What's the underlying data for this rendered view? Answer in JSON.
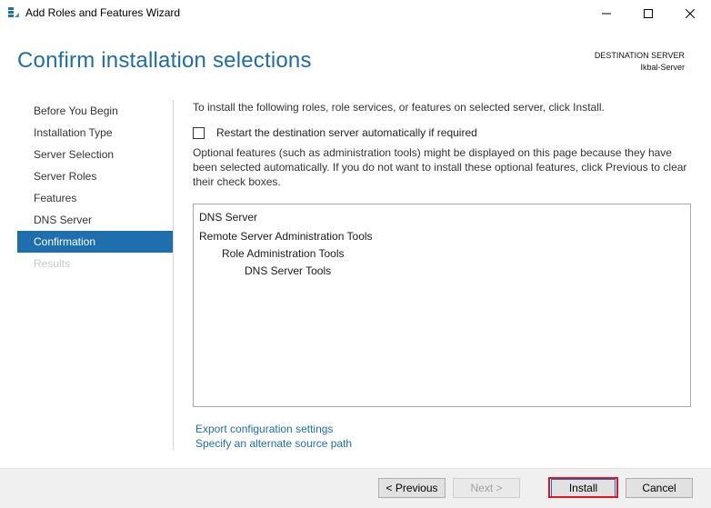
{
  "window": {
    "title": "Add Roles and Features Wizard"
  },
  "header": {
    "title": "Confirm installation selections",
    "destination_label": "DESTINATION SERVER",
    "destination_value": "Ikbal-Server"
  },
  "sidebar": {
    "items": [
      {
        "label": "Before You Begin",
        "state": "normal"
      },
      {
        "label": "Installation Type",
        "state": "normal"
      },
      {
        "label": "Server Selection",
        "state": "normal"
      },
      {
        "label": "Server Roles",
        "state": "normal"
      },
      {
        "label": "Features",
        "state": "normal"
      },
      {
        "label": "DNS Server",
        "state": "normal"
      },
      {
        "label": "Confirmation",
        "state": "active"
      },
      {
        "label": "Results",
        "state": "disabled"
      }
    ]
  },
  "main": {
    "intro": "To install the following roles, role services, or features on selected server, click Install.",
    "restart_checkbox_label": "Restart the destination server automatically if required",
    "restart_checked": false,
    "optional_text": "Optional features (such as administration tools) might be displayed on this page because they have been selected automatically. If you do not want to install these optional features, click Previous to clear their check boxes.",
    "features": [
      {
        "label": "DNS Server",
        "level": 0
      },
      {
        "label": "Remote Server Administration Tools",
        "level": 0
      },
      {
        "label": "Role Administration Tools",
        "level": 1
      },
      {
        "label": "DNS Server Tools",
        "level": 2
      }
    ],
    "export_link": "Export configuration settings",
    "alternate_source_link": "Specify an alternate source path"
  },
  "footer": {
    "previous_label": "< Previous",
    "next_label": "Next >",
    "install_label": "Install",
    "cancel_label": "Cancel"
  },
  "colors": {
    "accent": "#1f6ead",
    "header_text": "#1e6ea6",
    "highlight": "#e81123"
  },
  "icons": [
    "server-manager-icon",
    "minimize-icon",
    "maximize-icon",
    "close-icon"
  ]
}
